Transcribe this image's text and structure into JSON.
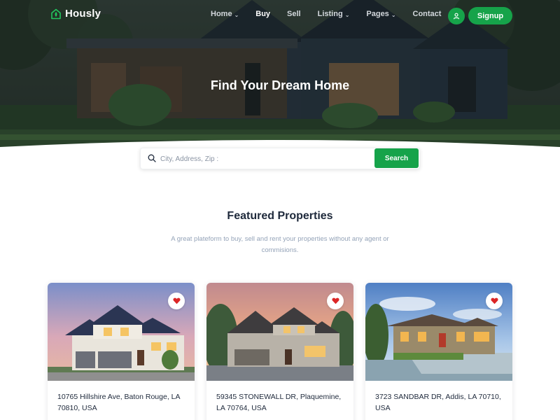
{
  "brand": {
    "name": "Hously",
    "accent": "#16a34a"
  },
  "nav": {
    "items": [
      {
        "label": "Home",
        "dropdown": true,
        "active": false
      },
      {
        "label": "Buy",
        "dropdown": false,
        "active": true
      },
      {
        "label": "Sell",
        "dropdown": false,
        "active": false
      },
      {
        "label": "Listing",
        "dropdown": true,
        "active": false
      },
      {
        "label": "Pages",
        "dropdown": true,
        "active": false
      },
      {
        "label": "Contact",
        "dropdown": false,
        "active": false
      }
    ],
    "profile_icon": "user-icon",
    "signup_label": "Signup"
  },
  "hero": {
    "title": "Find Your Dream Home"
  },
  "search": {
    "placeholder": "City, Address, Zip :",
    "value": "",
    "button_label": "Search",
    "icon": "search-icon"
  },
  "featured": {
    "title": "Featured Properties",
    "subtitle": "A great plateform to buy, sell and rent your properties without any agent or commisions.",
    "properties": [
      {
        "address": "10765 Hillshire Ave, Baton Rouge, LA 70810, USA",
        "favorite_icon": "heart-icon"
      },
      {
        "address": "59345 STONEWALL DR, Plaquemine, LA 70764, USA",
        "favorite_icon": "heart-icon"
      },
      {
        "address": "3723 SANDBAR DR, Addis, LA 70710, USA",
        "favorite_icon": "heart-icon"
      }
    ]
  },
  "colors": {
    "heart": "#dc2626",
    "text_dark": "#1e293b",
    "text_muted": "#94a3b8"
  }
}
